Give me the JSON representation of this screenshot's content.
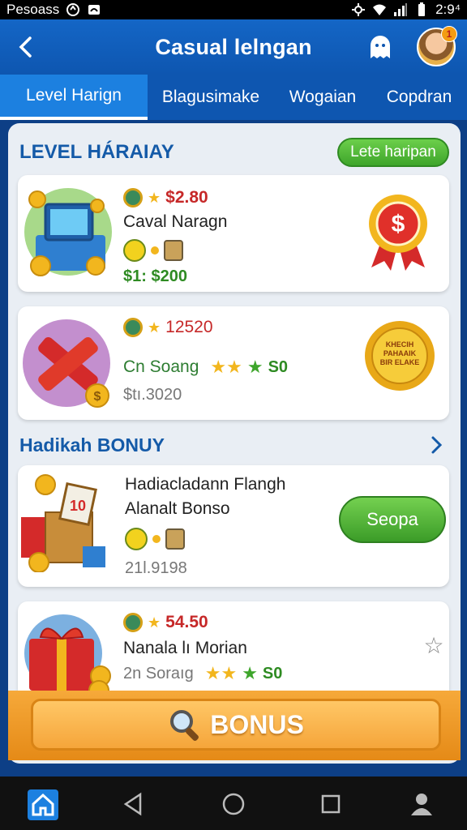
{
  "status_bar": {
    "carrier": "Pesoass",
    "time": "2:9⁴"
  },
  "header": {
    "title": "Casual lelngan",
    "avatar_badge": "1"
  },
  "tabs": [
    {
      "label": "Level Harign",
      "active": true
    },
    {
      "label": "Blagusimake",
      "active": false
    },
    {
      "label": "Wogaian",
      "active": false
    },
    {
      "label": "Copdran",
      "active": false
    }
  ],
  "section1": {
    "title": "LEVEL HÁRAIAY",
    "button": "Lete haripan"
  },
  "cards1": [
    {
      "price": "$2.80",
      "name": "Caval Naragn",
      "extra": "$1: $200",
      "badge_icon": "dollar-rosette-icon"
    },
    {
      "price": "12520",
      "name": "Cn Soang",
      "rating": "S0",
      "sub": "$tı.3020",
      "badge_text": "KHECIH PAHAAIK BIR ELAKE",
      "badge_icon": "gold-seal-icon"
    }
  ],
  "section2": {
    "title": "Hadikah BONUY"
  },
  "cards2": [
    {
      "name_line1": "Hadiacladann Flangh",
      "name_line2": "Alanalt Bonso",
      "sub": "21l.9198",
      "button": "Seopa"
    },
    {
      "price": "54.50",
      "name": "Nanala lı Morian",
      "sub": "2n Soraıg",
      "rating": "S0"
    }
  ],
  "bonus": {
    "label": "BONUS"
  },
  "colors": {
    "primary": "#0e56b0",
    "accent": "#f5a53a",
    "green": "#3ea52b",
    "price_red": "#c62828"
  }
}
